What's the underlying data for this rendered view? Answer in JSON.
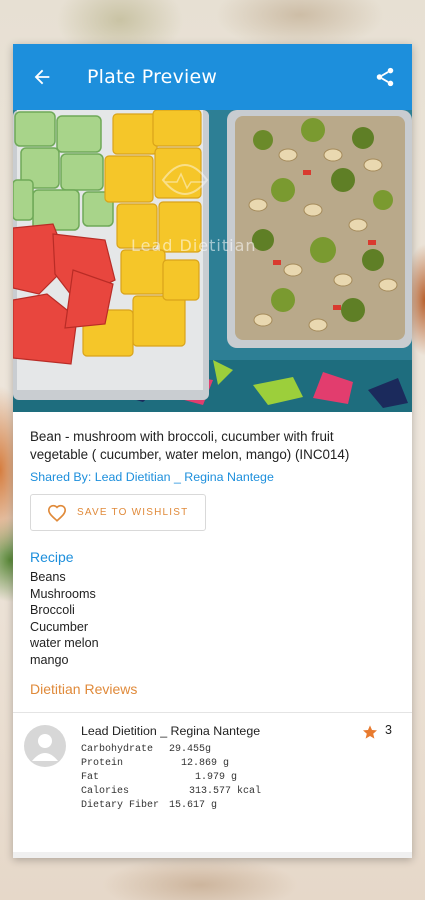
{
  "appbar": {
    "title": "Plate Preview",
    "back_icon": "arrow-back-icon",
    "share_icon": "share-icon",
    "color": "#1d8fdc"
  },
  "photo": {
    "watermark_text": "Lead Dietitian"
  },
  "meal": {
    "title": "Bean - mushroom with broccoli, cucumber with fruit vegetable ( cucumber, water melon, mango) (INC014)",
    "shared_by": "Shared By: Lead Dietitian _ Regina Nantege"
  },
  "wishlist": {
    "label": "SAVE TO WISHLIST",
    "icon": "heart-outline-icon",
    "accent": "#e08a3a"
  },
  "recipe": {
    "heading": "Recipe",
    "items": [
      "Beans",
      "Mushrooms",
      "Broccoli",
      "Cucumber",
      "water melon",
      "mango"
    ]
  },
  "reviews": {
    "heading": "Dietitian Reviews",
    "items": [
      {
        "name": "Lead Dietition _ Regina Nantege",
        "rating": "3",
        "nutrition": [
          {
            "k": "Carbohydrate",
            "v": "29.455g"
          },
          {
            "k": "Protein",
            "v": "12.869 g"
          },
          {
            "k": "Fat",
            "v": "1.979 g"
          },
          {
            "k": "Calories",
            "v": "313.577 kcal"
          },
          {
            "k": "Dietary Fiber",
            "v": "15.617 g"
          }
        ]
      }
    ]
  }
}
